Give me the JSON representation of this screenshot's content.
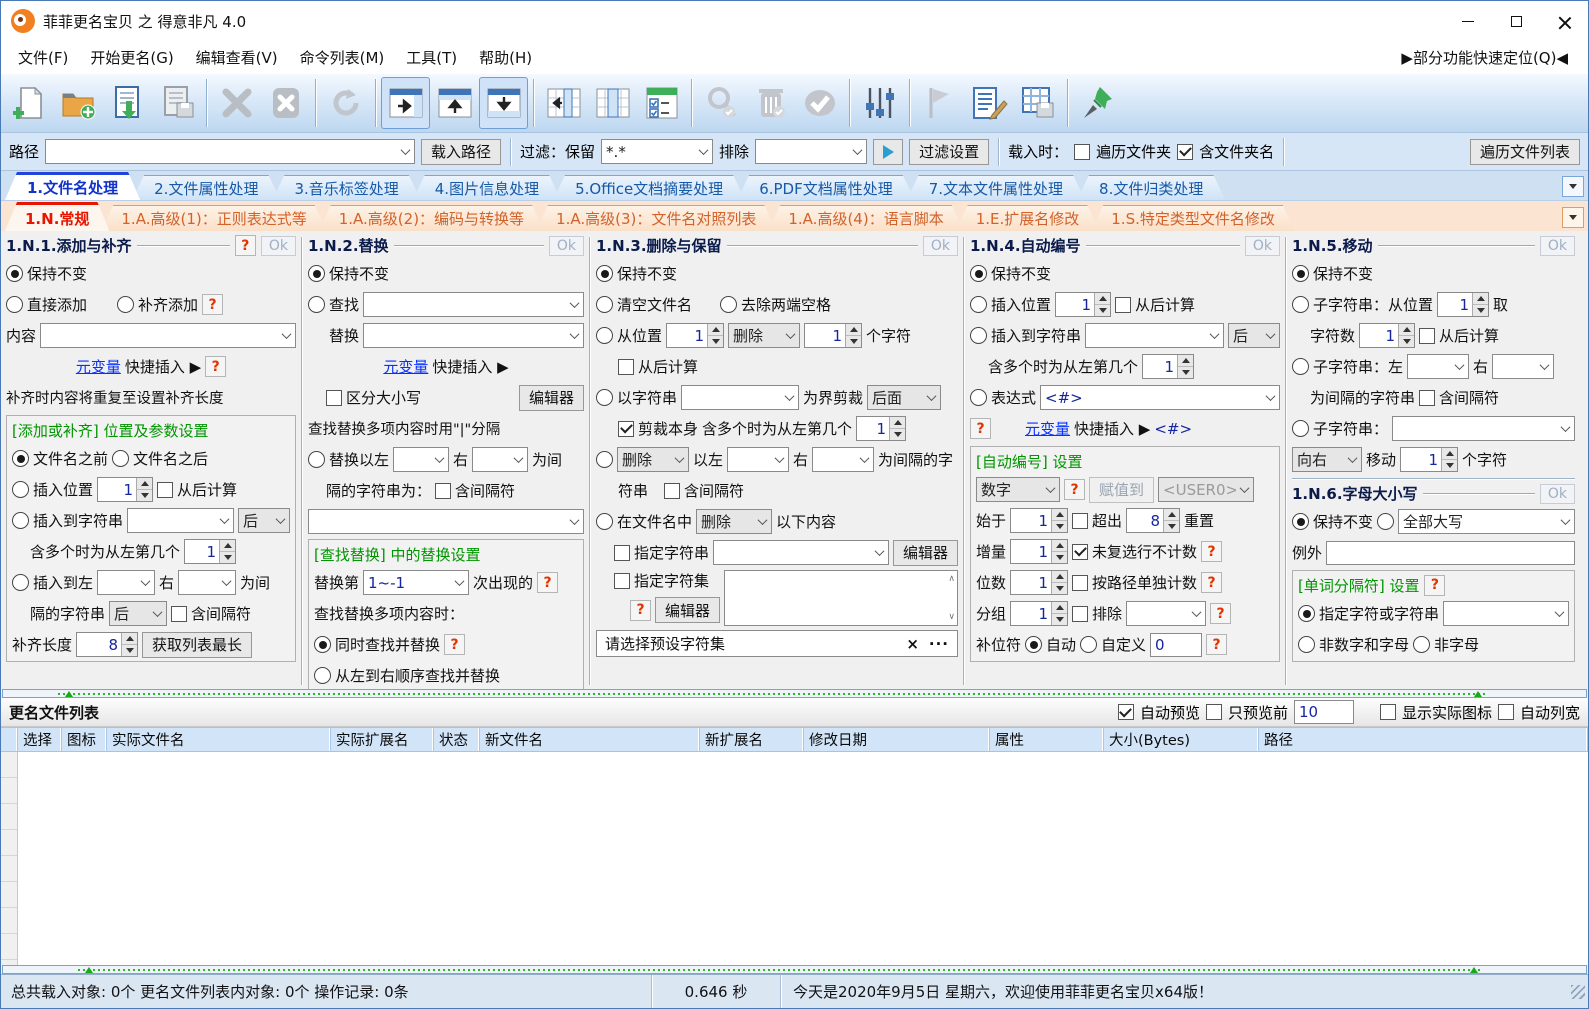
{
  "ui": {
    "ok": "Ok",
    "help": "?",
    "close_x": "×",
    "more": "···"
  },
  "window": {
    "title": "菲菲更名宝贝 之 得意非凡 4.0",
    "quick_locate": "▶部分功能快速定位(Q)◀"
  },
  "menu": {
    "items": [
      "文件(F)",
      "开始更名(G)",
      "编辑查看(V)",
      "命令列表(M)",
      "工具(T)",
      "帮助(H)"
    ]
  },
  "pathbar": {
    "path_label": "路径",
    "load_path_btn": "载入路径",
    "filter_label": "过滤：保留",
    "filter_value": "*.*",
    "exclude_label": "排除",
    "filter_settings_btn": "过滤设置",
    "on_load_label": "载入时：",
    "traverse_folders": "遍历文件夹",
    "include_folder_name": "含文件夹名",
    "traverse_list_btn": "遍历文件列表"
  },
  "tabs_main": [
    "1.文件名处理",
    "2.文件属性处理",
    "3.音乐标签处理",
    "4.图片信息处理",
    "5.Office文档摘要处理",
    "6.PDF文档属性处理",
    "7.文本文件属性处理",
    "8.文件归类处理"
  ],
  "tabs_sub": [
    "1.N.常规",
    "1.A.高级(1)：正则表达式等",
    "1.A.高级(2)：编码与转换等",
    "1.A.高级(3)：文件名对照列表",
    "1.A.高级(4)：语言脚本",
    "1.E.扩展名修改",
    "1.S.特定类型文件名修改"
  ],
  "p1": {
    "title": "1.N.1.添加与补齐",
    "keep": "保持不变",
    "direct": "直接添加",
    "pad": "补齐添加",
    "content": "内容",
    "metavar": "元变量",
    "quick": "快捷插入 ▶",
    "note": "补齐时内容将重复至设置补齐长度",
    "group": "[添加或补齐] 位置及参数设置",
    "before": "文件名之前",
    "after": "文件名之后",
    "ins_pos": "插入位置",
    "ins_pos_v": "1",
    "from_end": "从后计算",
    "ins_str": "插入到字符串",
    "pos_after": "后",
    "multi": "含多个时为从左第几个",
    "multi_v": "1",
    "ins_between": "插入到左",
    "right": "右",
    "wei_jian": "为间",
    "sep_str": "隔的字符串",
    "sep_after": "后",
    "inc_sep": "含间隔符",
    "pad_len": "补齐长度",
    "pad_len_v": "8",
    "get_longest": "获取列表最长"
  },
  "p2": {
    "title": "1.N.2.替换",
    "keep": "保持不变",
    "find": "查找",
    "repl": "替换",
    "metavar": "元变量",
    "quick": "快捷插入 ▶",
    "case_sens": "区分大小写",
    "editor": "编辑器",
    "multi_note": "查找替换多项内容时用\"|\"分隔",
    "repl_between": "替换以左",
    "right": "右",
    "wei_jian": "为间",
    "sep_line": "隔的字符串为：",
    "inc_sep": "含间隔符",
    "group": "[查找替换] 中的替换设置",
    "nth": "替换第",
    "nth_v": "1~-1",
    "occur": "次出现的",
    "multi_when": "查找替换多项内容时：",
    "simul": "同时查找并替换",
    "seq": "从左到右顺序查找并替换"
  },
  "p3": {
    "title": "1.N.3.删除与保留",
    "keep": "保持不变",
    "clear": "清空文件名",
    "trim": "去除两端空格",
    "from_pos": "从位置",
    "v1": "1",
    "del": "删除",
    "v2": "1",
    "chars": "个字符",
    "from_end": "从后计算",
    "by_str": "以字符串",
    "cut": "为界剪裁",
    "behind": "后面",
    "cut_self": "剪裁本身",
    "multi": "含多个时为从左第几个",
    "v3": "1",
    "between_l": "以左",
    "right": "右",
    "sep_a": "为间隔的字",
    "sep_b": "符串",
    "inc_sep": "含间隔符",
    "in_name": "在文件名中",
    "following": "以下内容",
    "spec_str": "指定字符串",
    "editor": "编辑器",
    "spec_set": "指定字符集",
    "preset": "请选择预设字符集"
  },
  "p4": {
    "title": "1.N.4.自动编号",
    "keep": "保持不变",
    "ins_pos": "插入位置",
    "v1": "1",
    "from_end": "从后计算",
    "ins_str": "插入到字符串",
    "pos_after": "后",
    "multi": "含多个时为从左第几个",
    "v2": "1",
    "expr": "表达式",
    "expr_v": "<#>",
    "metavar": "元变量",
    "quick": "快捷插入 ▶",
    "tag": "<#>",
    "group": "[自动编号] 设置",
    "type_v": "数字",
    "assign": "赋值到",
    "user_v": "<USER0>",
    "start": "始于",
    "start_v": "1",
    "exceed": "超出",
    "exceed_v": "8",
    "reset": "重置",
    "inc": "增量",
    "inc_v": "1",
    "noskip": "未复选行不计数",
    "digits": "位数",
    "digits_v": "1",
    "perpath": "按路径单独计数",
    "grp": "分组",
    "grp_v": "1",
    "excl": "排除",
    "padchar": "补位符",
    "auto": "自动",
    "custom": "自定义",
    "custom_v": "0"
  },
  "p5": {
    "title": "1.N.5.移动",
    "keep": "保持不变",
    "sub_pos": "子字符串：从位置",
    "v1": "1",
    "take": "取",
    "chars_n": "字符数",
    "v2": "1",
    "from_end": "从后计算",
    "sub_lr": "子字符串：左",
    "right": "右",
    "sep": "为间隔的字符串",
    "inc_sep": "含间隔符",
    "sub_s": "子字符串：",
    "dir_v": "向右",
    "move": "移动",
    "v3": "1",
    "chars": "个字符"
  },
  "p6": {
    "title": "1.N.6.字母大小写",
    "keep": "保持不变",
    "upper_v": "全部大写",
    "except": "例外",
    "group": "[单词分隔符] 设置",
    "spec": "指定字符或字符串",
    "non_alnum": "非数字和字母",
    "non_alpha": "非字母"
  },
  "list": {
    "title": "更名文件列表",
    "auto_preview": "自动预览",
    "preview_first": "只预览前",
    "preview_count": "10",
    "show_real_icons": "显示实际图标",
    "auto_col_width": "自动列宽",
    "columns": [
      "选择",
      "图标",
      "实际文件名",
      "实际扩展名",
      "状态",
      "新文件名",
      "新扩展名",
      "修改日期",
      "属性",
      "大小(Bytes)",
      "路径"
    ]
  },
  "status": {
    "counts": "总共载入对象: 0个  更名文件列表内对象: 0个  操作记录: 0条",
    "time": "0.646 秒",
    "welcome": "今天是2020年9月5日 星期六，欢迎使用菲菲更名宝贝x64版！"
  },
  "colors": {
    "accent": "#2b6cd4",
    "tab_active": "#1133cc",
    "sub_active": "#e81500",
    "green_title": "#009600",
    "link": "#0530ff"
  }
}
